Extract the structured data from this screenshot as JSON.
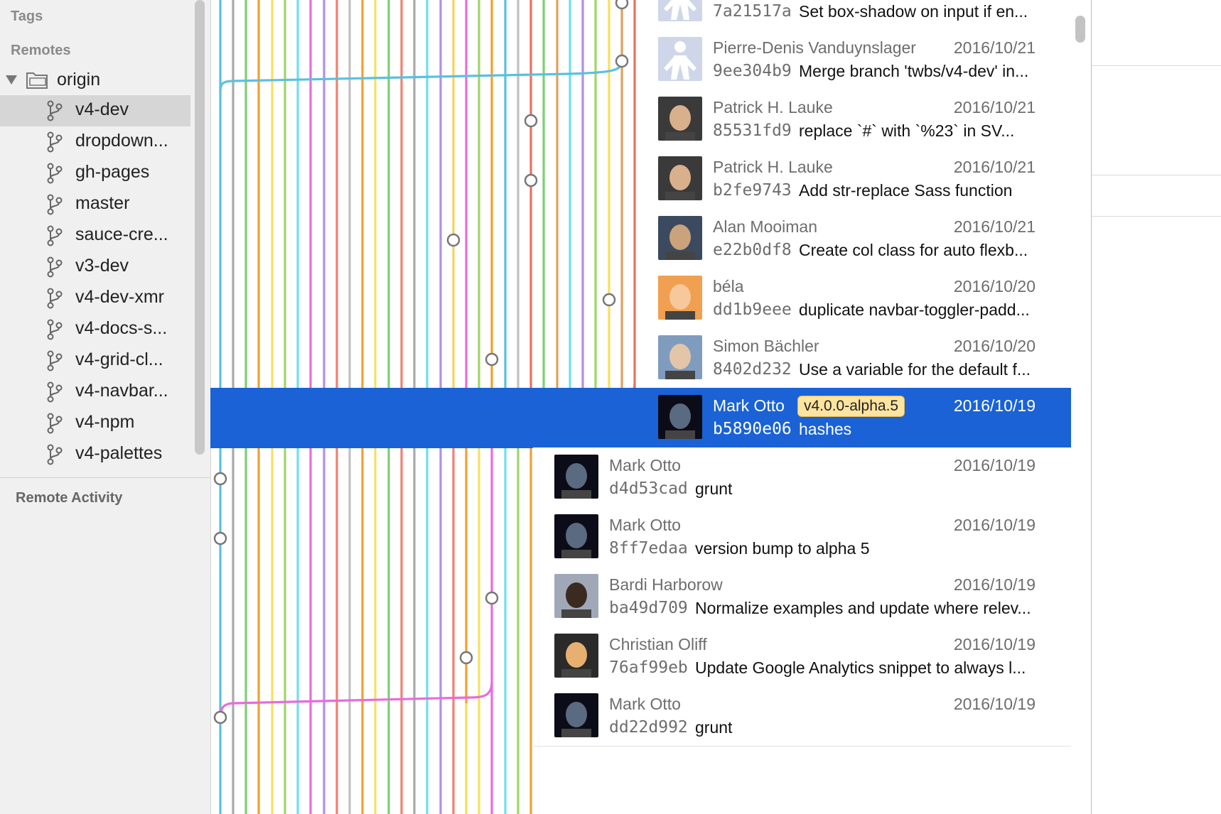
{
  "sidebar": {
    "tags_label": "Tags",
    "remotes_label": "Remotes",
    "origin_label": "origin",
    "remote_activity_label": "Remote Activity",
    "branches": [
      {
        "label": "v4-dev",
        "selected": true
      },
      {
        "label": "dropdown...",
        "selected": false
      },
      {
        "label": "gh-pages",
        "selected": false
      },
      {
        "label": "master",
        "selected": false
      },
      {
        "label": "sauce-cre...",
        "selected": false
      },
      {
        "label": "v3-dev",
        "selected": false
      },
      {
        "label": "v4-dev-xmr",
        "selected": false
      },
      {
        "label": "v4-docs-s...",
        "selected": false
      },
      {
        "label": "v4-grid-cl...",
        "selected": false
      },
      {
        "label": "v4-navbar...",
        "selected": false
      },
      {
        "label": "v4-npm",
        "selected": false
      },
      {
        "label": "v4-palettes",
        "selected": false
      }
    ]
  },
  "graph_colors": [
    "#5bc0de",
    "#a9a9a9",
    "#7dcf73",
    "#f0a030",
    "#f5e15f",
    "#a0d468",
    "#e86bdb",
    "#b48ee6",
    "#f08070",
    "#c0c0c0",
    "#6fe0e8",
    "#f4d35e",
    "#ec6f5e",
    "#e0a060"
  ],
  "commits": [
    {
      "author": "",
      "date": "",
      "sha": "7a21517a",
      "message": "Set box-shadow on input if en...",
      "avatar": "ironman-icon",
      "tag": ""
    },
    {
      "author": "Pierre-Denis Vanduynslager",
      "date": "2016/10/21",
      "sha": "9ee304b9",
      "message": "Merge branch 'twbs/v4-dev' in...",
      "avatar": "ironman-icon",
      "tag": ""
    },
    {
      "author": "Patrick H. Lauke",
      "date": "2016/10/21",
      "sha": "85531fd9",
      "message": "replace `#` with `%23` in SV...",
      "avatar": "person-avatar",
      "tag": ""
    },
    {
      "author": "Patrick H. Lauke",
      "date": "2016/10/21",
      "sha": "b2fe9743",
      "message": "Add str-replace Sass function",
      "avatar": "person-avatar",
      "tag": ""
    },
    {
      "author": "Alan Mooiman",
      "date": "2016/10/21",
      "sha": "e22b0df8",
      "message": "Create col class for auto flexb...",
      "avatar": "person-avatar",
      "tag": ""
    },
    {
      "author": "béla",
      "date": "2016/10/20",
      "sha": "dd1b9eee",
      "message": "duplicate navbar-toggler-padd...",
      "avatar": "person-avatar",
      "tag": ""
    },
    {
      "author": "Simon Bächler",
      "date": "2016/10/20",
      "sha": "8402d232",
      "message": "Use a variable for the default f...",
      "avatar": "person-avatar",
      "tag": ""
    },
    {
      "author": "Mark Otto",
      "date": "2016/10/19",
      "sha": "b5890e06",
      "message": "hashes",
      "avatar": "person-avatar",
      "tag": "v4.0.0-alpha.5"
    },
    {
      "author": "Mark Otto",
      "date": "2016/10/19",
      "sha": "d4d53cad",
      "message": "grunt",
      "avatar": "person-avatar",
      "tag": ""
    },
    {
      "author": "Mark Otto",
      "date": "2016/10/19",
      "sha": "8ff7edaa",
      "message": "version bump to alpha 5",
      "avatar": "person-avatar",
      "tag": ""
    },
    {
      "author": "Bardi Harborow",
      "date": "2016/10/19",
      "sha": "ba49d709",
      "message": "Normalize examples and update where relev...",
      "avatar": "person-avatar",
      "tag": ""
    },
    {
      "author": "Christian Oliff",
      "date": "2016/10/19",
      "sha": "76af99eb",
      "message": "Update Google Analytics snippet to always l...",
      "avatar": "person-avatar",
      "tag": ""
    },
    {
      "author": "Mark Otto",
      "date": "2016/10/19",
      "sha": "dd22d992",
      "message": "grunt",
      "avatar": "person-avatar",
      "tag": ""
    }
  ]
}
